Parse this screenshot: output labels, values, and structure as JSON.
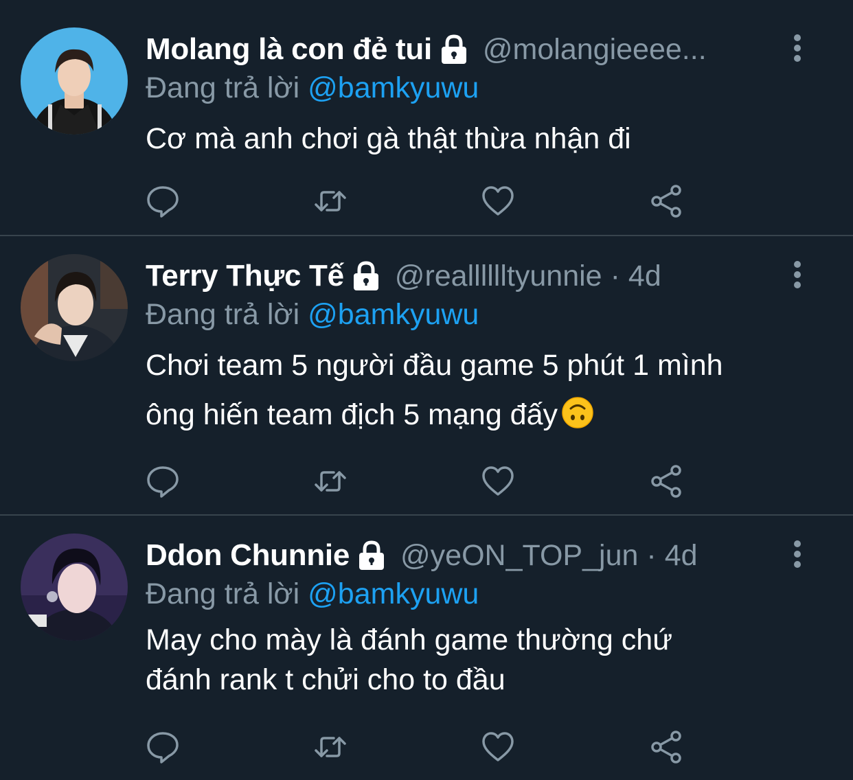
{
  "theme": {
    "background": "#15202b",
    "divider": "#38444d",
    "text_primary": "#ffffff",
    "text_secondary": "#8899a6",
    "mention": "#1da1f2"
  },
  "icons": {
    "reply": "speech-bubble-icon",
    "retweet": "retweet-arrows-icon",
    "like": "heart-icon",
    "share": "share-icon",
    "protected": "lock-icon",
    "more": "vertical-dots-icon"
  },
  "tweets": [
    {
      "display_name": "Molang là con đẻ tui",
      "handle": "@molangieeee...",
      "separator": "",
      "time": "",
      "reply_prefix": "Đang trả lời",
      "reply_to": "@bamkyuwu",
      "text_lines": [
        "Cơ mà anh chơi gà thật thừa nhận đi"
      ],
      "avatar_bg": "#4fb3e8"
    },
    {
      "display_name": "Terry Thực Tế",
      "handle": "@realllllltyunnie",
      "separator": "·",
      "time": "4d",
      "reply_prefix": "Đang trả lời",
      "reply_to": "@bamkyuwu",
      "text_lines": [
        "Chơi team 5 người đầu game 5 phút 1 mình",
        "ông hiến team địch 5 mạng đấy"
      ],
      "emoji": "upside-down-face",
      "avatar_bg": "#2a2f36"
    },
    {
      "display_name": "Ddon Chunnie",
      "handle": "@yeON_TOP_jun",
      "separator": "·",
      "time": "4d",
      "reply_prefix": "Đang trả lời",
      "reply_to": "@bamkyuwu",
      "text_lines": [
        "May cho mày là đánh game thường chứ",
        "đánh rank t chửi cho to đầu"
      ],
      "avatar_bg": "#3a2f5c"
    }
  ]
}
